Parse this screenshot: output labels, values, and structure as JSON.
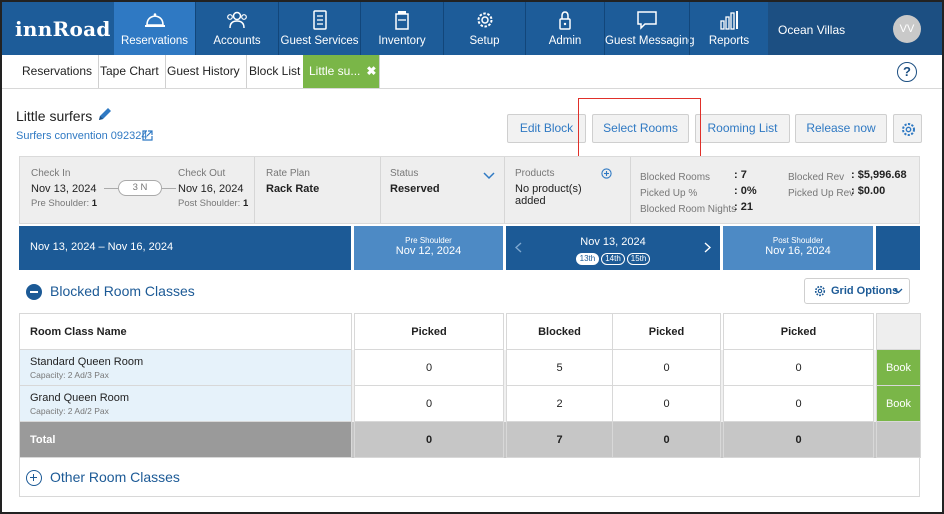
{
  "app": {
    "logo": "innRoad",
    "property_name": "Ocean Villas",
    "avatar_initials": "VV",
    "help_label": "?"
  },
  "nav": [
    {
      "label": "Reservations",
      "icon": "bell-icon",
      "active": true
    },
    {
      "label": "Accounts",
      "icon": "people-icon",
      "active": false
    },
    {
      "label": "Guest Services",
      "icon": "clipboard-icon",
      "active": false
    },
    {
      "label": "Inventory",
      "icon": "box-icon",
      "active": false
    },
    {
      "label": "Setup",
      "icon": "gear-icon",
      "active": false
    },
    {
      "label": "Admin",
      "icon": "lock-icon",
      "active": false
    },
    {
      "label": "Guest Messaging",
      "icon": "chat-icon",
      "active": false
    },
    {
      "label": "Reports",
      "icon": "bar-chart-icon",
      "active": false
    }
  ],
  "tabs": [
    {
      "label": "Reservations"
    },
    {
      "label": "Tape Chart"
    },
    {
      "label": "Guest History"
    },
    {
      "label": "Block List"
    },
    {
      "label": "Little su...",
      "close": "✖",
      "active": true
    }
  ],
  "block": {
    "title": "Little surfers",
    "group_link": "Surfers convention 092324"
  },
  "actions": {
    "edit_block": "Edit Block",
    "select_rooms": "Select Rooms",
    "rooming_list": "Rooming List",
    "release_now": "Release now"
  },
  "summary": {
    "check_in_label": "Check In",
    "check_in": "Nov 13, 2024",
    "pre_shoulder_label": "Pre Shoulder:",
    "pre_shoulder": "1",
    "nights": "3 N",
    "check_out_label": "Check Out",
    "check_out": "Nov 16, 2024",
    "post_shoulder_label": "Post Shoulder:",
    "post_shoulder": "1",
    "rate_plan_label": "Rate Plan",
    "rate_plan": "Rack Rate",
    "status_label": "Status",
    "status": "Reserved",
    "products_label": "Products",
    "products": "No product(s) added",
    "blocked_rooms_label": "Blocked Rooms",
    "blocked_rooms": ": 7",
    "picked_up_pct_label": "Picked Up %",
    "picked_up_pct": ": 0%",
    "blocked_room_nights_label": "Blocked Room Nights",
    "blocked_room_nights": ": 21",
    "blocked_rev_label": "Blocked Rev",
    "blocked_rev": ": $5,996.68",
    "picked_up_rev_label": "Picked Up Rev",
    "picked_up_rev": ": $0.00"
  },
  "dates": {
    "range": "Nov 13, 2024 – Nov 16, 2024",
    "pre_label": "Pre Shoulder",
    "pre_date": "Nov 12, 2024",
    "main_date": "Nov 13, 2024",
    "days": [
      "13th",
      "14th",
      "15th"
    ],
    "post_label": "Post Shoulder",
    "post_date": "Nov 16, 2024"
  },
  "blocked_section": {
    "title": "Blocked Room Classes",
    "grid_options": "Grid Options"
  },
  "grid": {
    "headers": [
      "Room Class Name",
      "Picked",
      "Blocked",
      "Picked",
      "Picked"
    ],
    "rows": [
      {
        "name": "Standard Queen Room",
        "capacity": "Capacity: 2 Ad/3 Pax",
        "pre_picked": "0",
        "blocked": "5",
        "picked": "0",
        "post_picked": "0",
        "action": "Book"
      },
      {
        "name": "Grand Queen Room",
        "capacity": "Capacity: 2 Ad/2 Pax",
        "pre_picked": "0",
        "blocked": "2",
        "picked": "0",
        "post_picked": "0",
        "action": "Book"
      }
    ],
    "total": {
      "label": "Total",
      "pre_picked": "0",
      "blocked": "7",
      "picked": "0",
      "post_picked": "0"
    }
  },
  "other_section": {
    "title": "Other Room Classes"
  },
  "colors": {
    "nav_bg": "#1d5c99",
    "nav_active": "#2f79c3",
    "accent_green": "#7ab648",
    "link_blue": "#2f79c3",
    "highlight_red": "#e0302a"
  }
}
